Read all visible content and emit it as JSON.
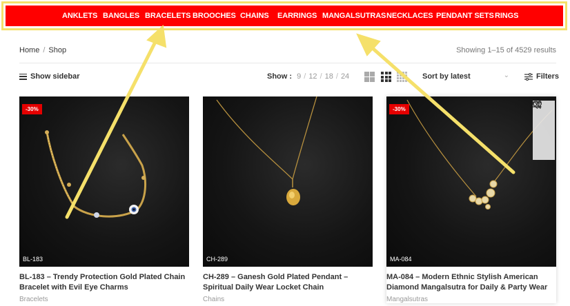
{
  "nav": {
    "items": [
      {
        "label": "ANKLETS"
      },
      {
        "label": "BANGLES"
      },
      {
        "label": "BRACELETS"
      },
      {
        "label": "BROOCHES"
      },
      {
        "label": "CHAINS"
      },
      {
        "label": "EARRINGS"
      },
      {
        "label": "MANGALSUTRAS"
      },
      {
        "label": "NECKLACES"
      },
      {
        "label": "PENDANT SETS"
      },
      {
        "label": "RINGS"
      }
    ],
    "bg_color": "#ff0000",
    "highlight_color": "#f5e06a"
  },
  "breadcrumb": {
    "home": "Home",
    "sep": "/",
    "current": "Shop"
  },
  "results": "Showing 1–15 of 4529 results",
  "toolbar": {
    "sidebar_label": "Show sidebar",
    "show_label": "Show :",
    "per_page": [
      "9",
      "12",
      "18",
      "24"
    ],
    "sort_label": "Sort by latest",
    "filters_label": "Filters"
  },
  "products": [
    {
      "badge": "-30%",
      "sku": "BL-183",
      "title": "BL-183 – Trendy Protection Gold Plated Chain Bracelet with Evil Eye Charms",
      "category": "Bracelets"
    },
    {
      "badge": "",
      "sku": "CH-289",
      "title": "CH-289 – Ganesh Gold Plated Pendant – Spiritual Daily Wear Locket Chain",
      "category": "Chains"
    },
    {
      "badge": "-30%",
      "sku": "MA-084",
      "title": "MA-084 – Modern Ethnic Stylish American Diamond Mangalsutra for Daily & Party Wear",
      "category": "Mangalsutras"
    }
  ],
  "icons": {
    "hamburger": "hamburger-icon",
    "grid2": "grid-2-icon",
    "grid3": "grid-3-icon",
    "grid4": "grid-4-icon",
    "sort_chevron": "chevron-down-icon",
    "filters": "filters-icon",
    "compare": "shuffle-icon",
    "quickview": "search-icon",
    "wishlist": "heart-icon"
  }
}
